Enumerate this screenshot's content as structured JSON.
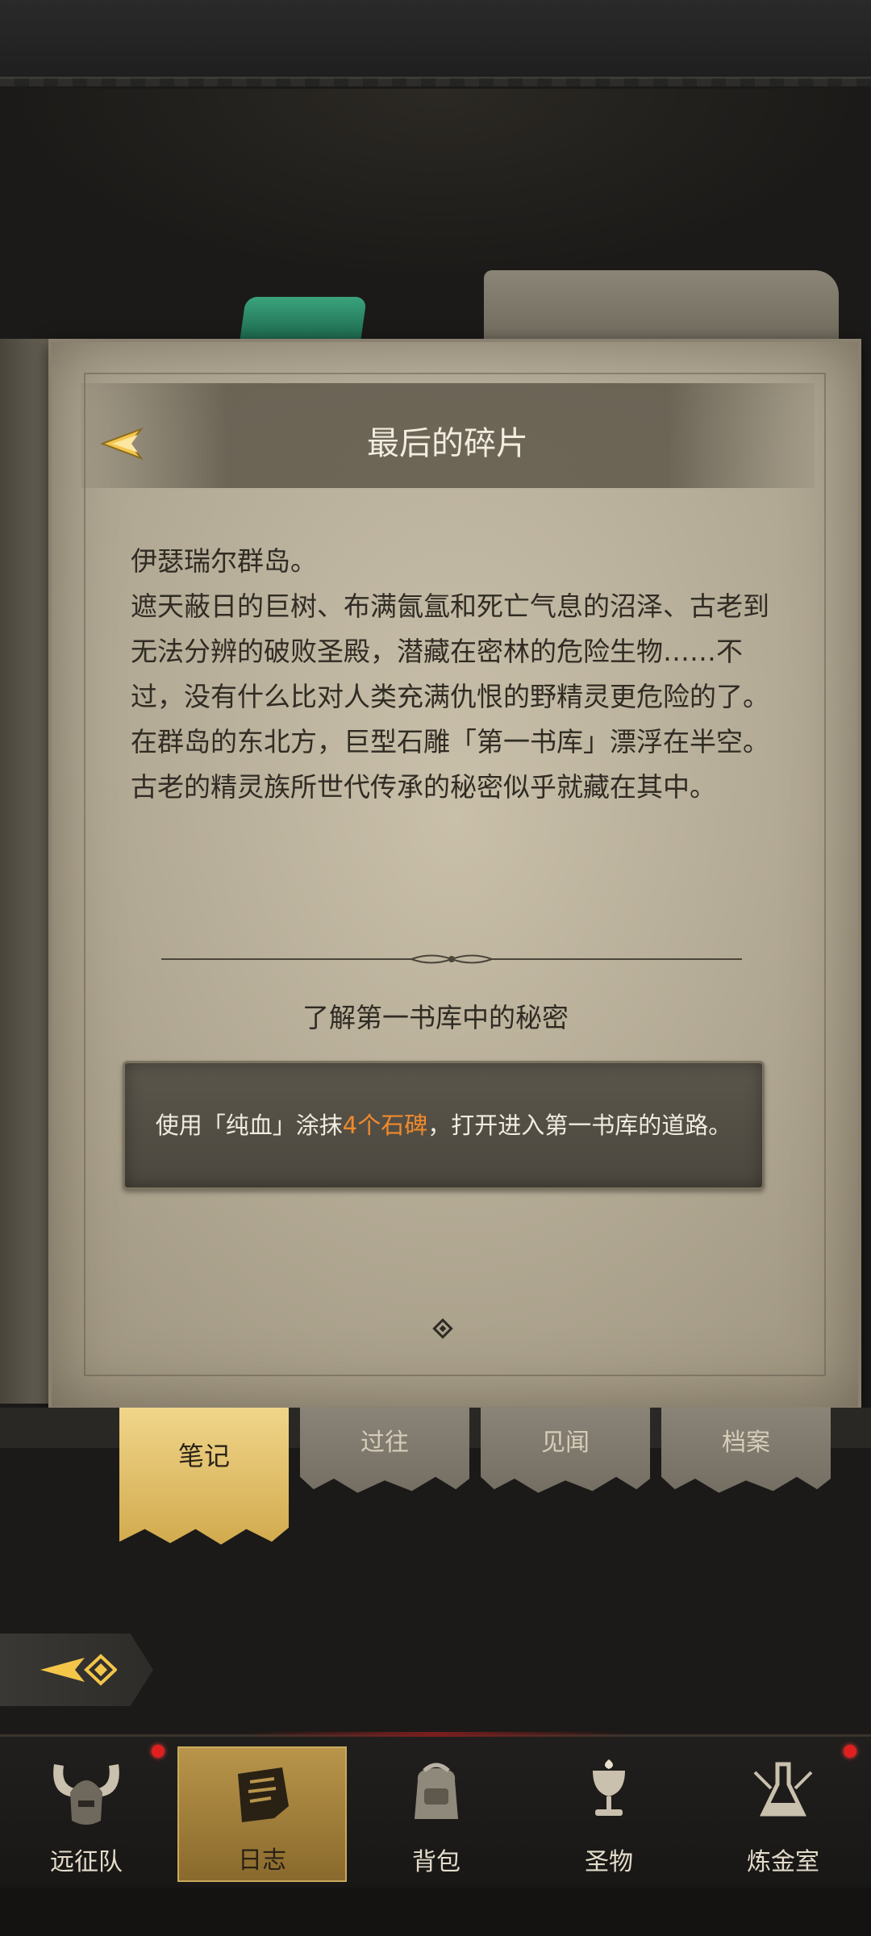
{
  "journal": {
    "title": "最后的碎片",
    "story": "伊瑟瑞尔群岛。\n遮天蔽日的巨树、布满氤氲和死亡气息的沼泽、古老到无法分辨的破败圣殿，潜藏在密林的危险生物……不过，没有什么比对人类充满仇恨的野精灵更危险的了。\n在群岛的东北方，巨型石雕「第一书库」漂浮在半空。古老的精灵族所世代传承的秘密似乎就藏在其中。",
    "quest_title": "了解第一书库中的秘密",
    "objective": {
      "before": "使用「纯血」涂抹",
      "highlight": "4个石碑",
      "after": "，打开进入第一书库的道路。",
      "highlight_color": "#f08a2c"
    }
  },
  "tabs": [
    {
      "label": "笔记",
      "active": true
    },
    {
      "label": "过往",
      "active": false
    },
    {
      "label": "见闻",
      "active": false
    },
    {
      "label": "档案",
      "active": false
    }
  ],
  "nav": [
    {
      "label": "远征队",
      "icon": "viking-helmet-icon",
      "badge": true,
      "active": false
    },
    {
      "label": "日志",
      "icon": "journal-scroll-icon",
      "badge": false,
      "active": true
    },
    {
      "label": "背包",
      "icon": "backpack-icon",
      "badge": false,
      "active": false
    },
    {
      "label": "圣物",
      "icon": "chalice-icon",
      "badge": false,
      "active": false
    },
    {
      "label": "炼金室",
      "icon": "alchemy-icon",
      "badge": true,
      "active": false
    }
  ],
  "colors": {
    "page": "#c8bfa9",
    "accent_gold": "#d1a94c",
    "badge_red": "#e01f1f"
  }
}
